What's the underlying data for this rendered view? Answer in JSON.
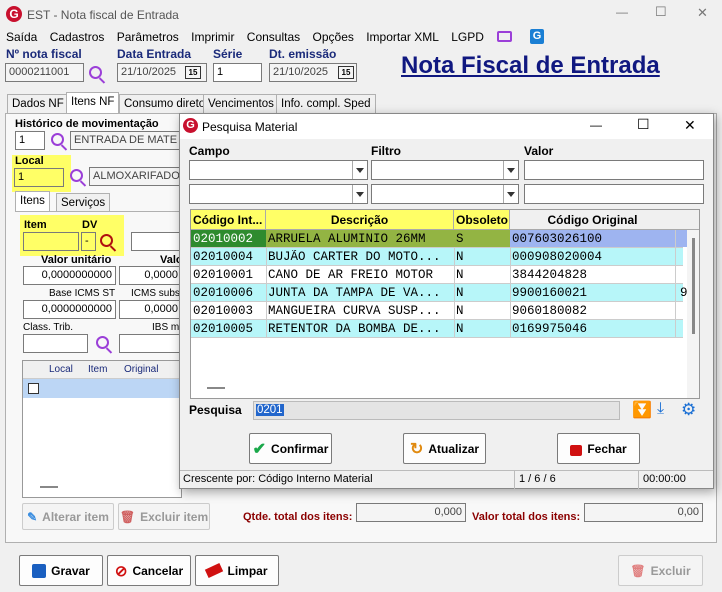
{
  "window": {
    "title": "EST - Nota fiscal de Entrada",
    "minimize": "—",
    "maximize": "☐",
    "close": "✕"
  },
  "menu": [
    "Saída",
    "Cadastros",
    "Parâmetros",
    "Imprimir",
    "Consultas",
    "Opções",
    "Importar XML",
    "LGPD"
  ],
  "header": {
    "nf_label": "Nº nota fiscal",
    "nf_value": "0000211001",
    "entry_label": "Data Entrada",
    "entry_value": "21/10/2025",
    "serie_label": "Série",
    "serie_value": "1",
    "emission_label": "Dt. emissão",
    "emission_value": "21/10/2025",
    "calendar_text": "15",
    "big_title": "Nota Fiscal de Entrada"
  },
  "tabs": [
    "Dados NF",
    "Itens NF",
    "Consumo direto",
    "Vencimentos",
    "Info. compl. Sped"
  ],
  "itens": {
    "hist_label": "Histórico de movimentação",
    "hist_code": "1",
    "hist_desc": "ENTRADA DE MATE",
    "local_label": "Local",
    "local_value": "1",
    "local_desc": "ALMOXARIFADO",
    "subtabs": [
      "Itens",
      "Serviços"
    ],
    "item_label": "Item",
    "dv_label": "DV",
    "dv_value": "-",
    "valor_unit_label": "Valor unitário",
    "valor_unit_value": "0,0000000000",
    "valor_other_label": "Valo",
    "valor_other_value": "0,0000",
    "base_icms_label": "Base ICMS ST",
    "base_icms_value": "0,0000000000",
    "icms_subs_label": "ICMS subs",
    "icms_subs_value": "0,0000",
    "class_label": "Class. Trib.",
    "ibs_label": "IBS m",
    "grid_headers": [
      "Local",
      "Item",
      "Original"
    ]
  },
  "bottom_inner": {
    "alterar": "Alterar item",
    "excluir": "Excluir item",
    "qtde_label": "Qtde. total dos itens:",
    "qtde_value": "0,000",
    "valor_label": "Valor total dos itens:",
    "valor_value": "0,00"
  },
  "footer": {
    "gravar": "Gravar",
    "cancelar": "Cancelar",
    "limpar": "Limpar",
    "excluir": "Excluir"
  },
  "dialog": {
    "title": "Pesquisa Material",
    "campo_label": "Campo",
    "filtro_label": "Filtro",
    "valor_label": "Valor",
    "columns": [
      "Código Int...",
      "Descrição",
      "Obsoleto",
      "Código Original"
    ],
    "rows": [
      {
        "code": "02010002",
        "desc": "ARRUELA ALUMINIO 26MM",
        "obs": "S",
        "orig": "007603026100",
        "extra": ""
      },
      {
        "code": "02010004",
        "desc": "BUJÃO CARTER DO MOTO...",
        "obs": "N",
        "orig": "000908020004",
        "extra": ""
      },
      {
        "code": "02010001",
        "desc": "CANO DE AR FREIO MOTOR",
        "obs": "N",
        "orig": "3844204828",
        "extra": ""
      },
      {
        "code": "02010006",
        "desc": "JUNTA DA TAMPA DE VA...",
        "obs": "N",
        "orig": "9900160021",
        "extra": "9"
      },
      {
        "code": "02010003",
        "desc": "MANGUEIRA CURVA SUSP...",
        "obs": "N",
        "orig": "9060180082",
        "extra": ""
      },
      {
        "code": "02010005",
        "desc": "RETENTOR DA BOMBA DE...",
        "obs": "N",
        "orig": "0169975046",
        "extra": ""
      }
    ],
    "pesquisa_label": "Pesquisa",
    "pesquisa_value": "0201",
    "confirmar": "Confirmar",
    "atualizar": "Atualizar",
    "fechar": "Fechar",
    "status_sort": "Crescente por: Código Interno Material",
    "status_count": "1 / 6 / 6",
    "status_time": "00:00:00"
  }
}
